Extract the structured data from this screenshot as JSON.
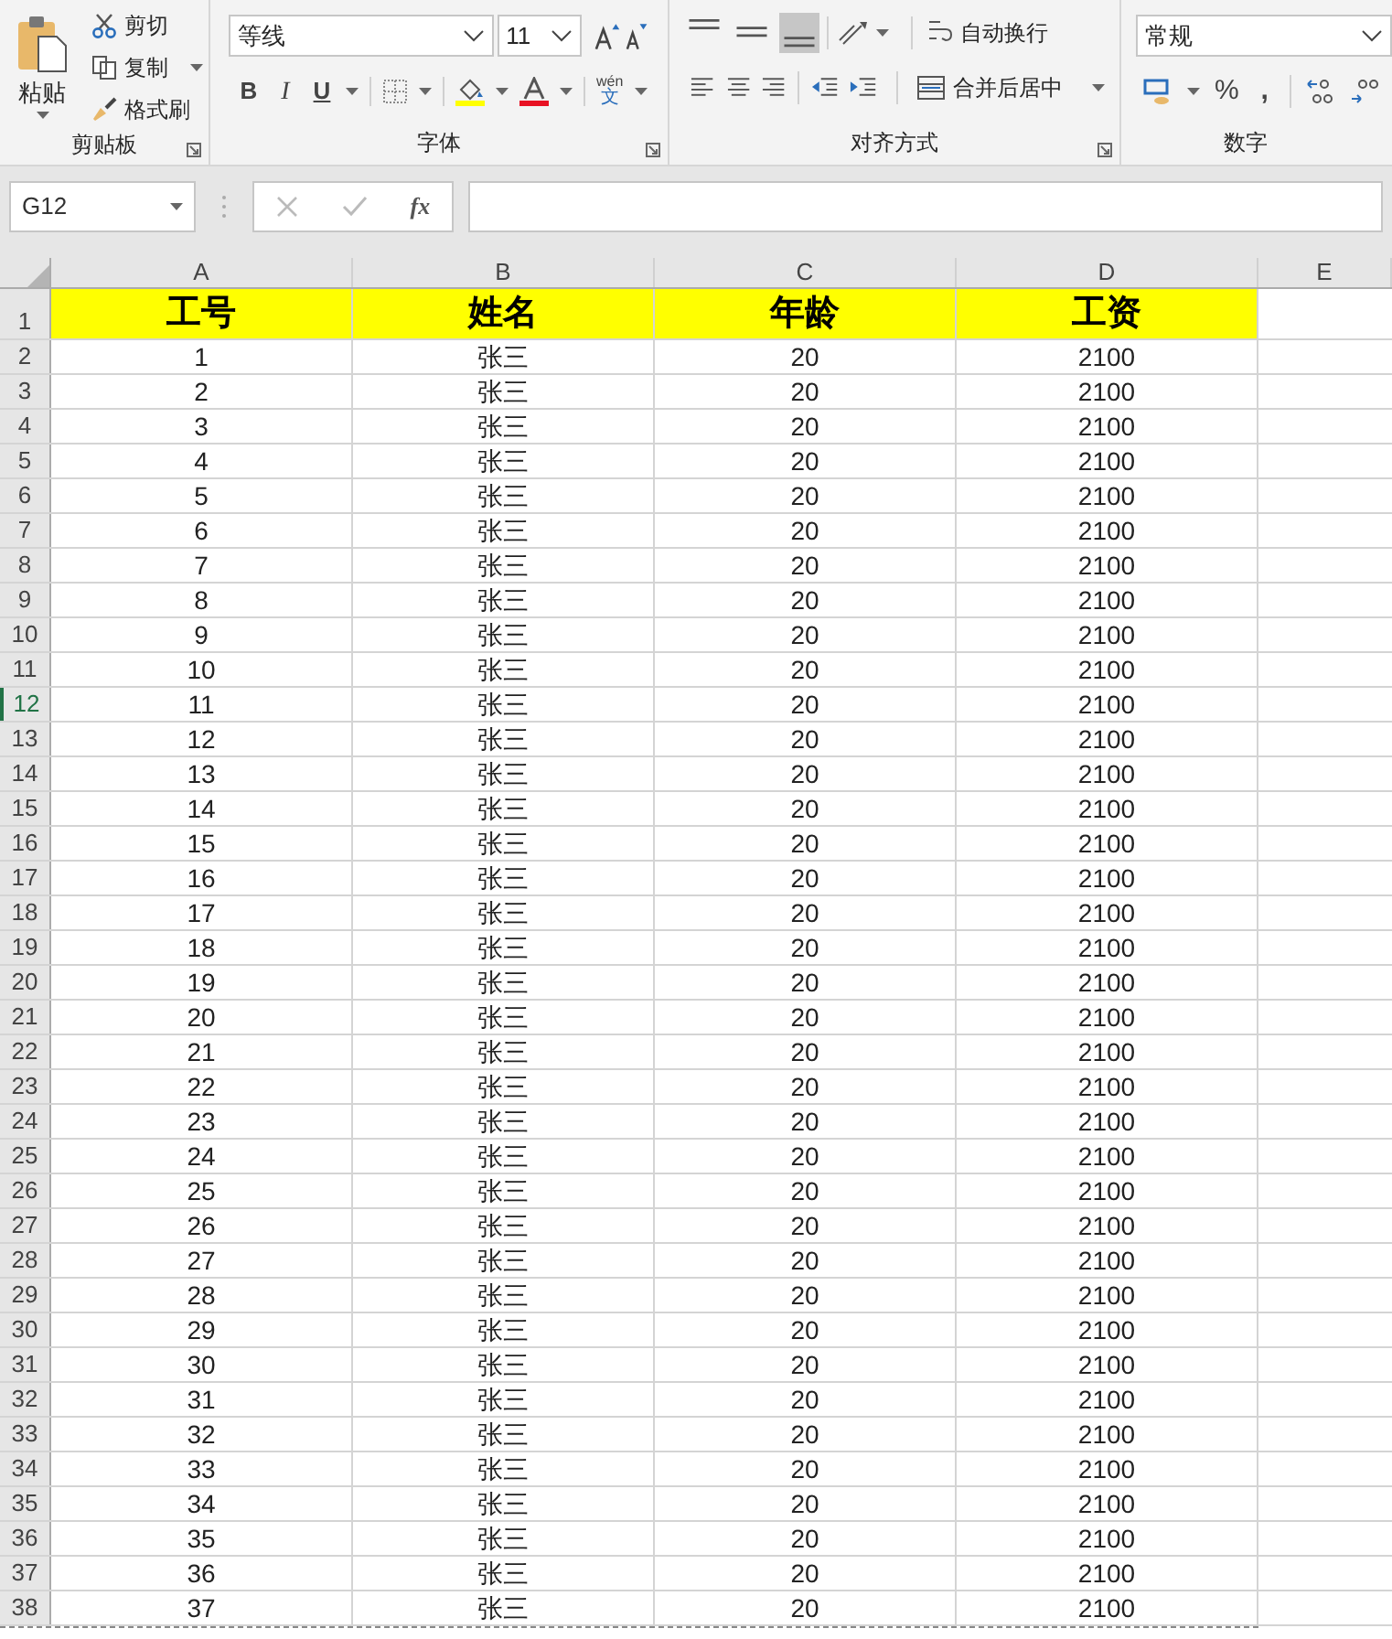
{
  "ribbon": {
    "clipboard": {
      "paste": "粘贴",
      "cut": "剪切",
      "copy": "复制",
      "format_painter": "格式刷",
      "label": "剪贴板"
    },
    "font": {
      "font_name": "等线",
      "font_size": "11",
      "bold": "B",
      "italic": "I",
      "underline": "U",
      "phonetic_top": "wén",
      "phonetic_bottom": "文",
      "label": "字体"
    },
    "alignment": {
      "wrap_text": "自动换行",
      "merge_center": "合并后居中",
      "label": "对齐方式"
    },
    "number": {
      "format": "常规",
      "percent": "%",
      "comma": ",",
      "label": "数字"
    }
  },
  "formula_bar": {
    "name_box": "G12",
    "fx": "fx"
  },
  "columns": [
    {
      "label": "A",
      "selected": false
    },
    {
      "label": "B",
      "selected": false
    },
    {
      "label": "C",
      "selected": false
    },
    {
      "label": "D",
      "selected": false
    },
    {
      "label": "E",
      "selected": false
    }
  ],
  "header_row": {
    "number": "1",
    "cells": [
      "工号",
      "姓名",
      "年龄",
      "工资"
    ]
  },
  "rows": [
    {
      "number": "2",
      "selected": false,
      "cells": [
        "1",
        "张三",
        "20",
        "2100"
      ]
    },
    {
      "number": "3",
      "selected": false,
      "cells": [
        "2",
        "张三",
        "20",
        "2100"
      ]
    },
    {
      "number": "4",
      "selected": false,
      "cells": [
        "3",
        "张三",
        "20",
        "2100"
      ]
    },
    {
      "number": "5",
      "selected": false,
      "cells": [
        "4",
        "张三",
        "20",
        "2100"
      ]
    },
    {
      "number": "6",
      "selected": false,
      "cells": [
        "5",
        "张三",
        "20",
        "2100"
      ]
    },
    {
      "number": "7",
      "selected": false,
      "cells": [
        "6",
        "张三",
        "20",
        "2100"
      ]
    },
    {
      "number": "8",
      "selected": false,
      "cells": [
        "7",
        "张三",
        "20",
        "2100"
      ]
    },
    {
      "number": "9",
      "selected": false,
      "cells": [
        "8",
        "张三",
        "20",
        "2100"
      ]
    },
    {
      "number": "10",
      "selected": false,
      "cells": [
        "9",
        "张三",
        "20",
        "2100"
      ]
    },
    {
      "number": "11",
      "selected": false,
      "cells": [
        "10",
        "张三",
        "20",
        "2100"
      ]
    },
    {
      "number": "12",
      "selected": true,
      "cells": [
        "11",
        "张三",
        "20",
        "2100"
      ]
    },
    {
      "number": "13",
      "selected": false,
      "cells": [
        "12",
        "张三",
        "20",
        "2100"
      ]
    },
    {
      "number": "14",
      "selected": false,
      "cells": [
        "13",
        "张三",
        "20",
        "2100"
      ]
    },
    {
      "number": "15",
      "selected": false,
      "cells": [
        "14",
        "张三",
        "20",
        "2100"
      ]
    },
    {
      "number": "16",
      "selected": false,
      "cells": [
        "15",
        "张三",
        "20",
        "2100"
      ]
    },
    {
      "number": "17",
      "selected": false,
      "cells": [
        "16",
        "张三",
        "20",
        "2100"
      ]
    },
    {
      "number": "18",
      "selected": false,
      "cells": [
        "17",
        "张三",
        "20",
        "2100"
      ]
    },
    {
      "number": "19",
      "selected": false,
      "cells": [
        "18",
        "张三",
        "20",
        "2100"
      ]
    },
    {
      "number": "20",
      "selected": false,
      "cells": [
        "19",
        "张三",
        "20",
        "2100"
      ]
    },
    {
      "number": "21",
      "selected": false,
      "cells": [
        "20",
        "张三",
        "20",
        "2100"
      ]
    },
    {
      "number": "22",
      "selected": false,
      "cells": [
        "21",
        "张三",
        "20",
        "2100"
      ]
    },
    {
      "number": "23",
      "selected": false,
      "cells": [
        "22",
        "张三",
        "20",
        "2100"
      ]
    },
    {
      "number": "24",
      "selected": false,
      "cells": [
        "23",
        "张三",
        "20",
        "2100"
      ]
    },
    {
      "number": "25",
      "selected": false,
      "cells": [
        "24",
        "张三",
        "20",
        "2100"
      ]
    },
    {
      "number": "26",
      "selected": false,
      "cells": [
        "25",
        "张三",
        "20",
        "2100"
      ]
    },
    {
      "number": "27",
      "selected": false,
      "cells": [
        "26",
        "张三",
        "20",
        "2100"
      ]
    },
    {
      "number": "28",
      "selected": false,
      "cells": [
        "27",
        "张三",
        "20",
        "2100"
      ]
    },
    {
      "number": "29",
      "selected": false,
      "cells": [
        "28",
        "张三",
        "20",
        "2100"
      ]
    },
    {
      "number": "30",
      "selected": false,
      "cells": [
        "29",
        "张三",
        "20",
        "2100"
      ]
    },
    {
      "number": "31",
      "selected": false,
      "cells": [
        "30",
        "张三",
        "20",
        "2100"
      ]
    },
    {
      "number": "32",
      "selected": false,
      "cells": [
        "31",
        "张三",
        "20",
        "2100"
      ]
    },
    {
      "number": "33",
      "selected": false,
      "cells": [
        "32",
        "张三",
        "20",
        "2100"
      ]
    },
    {
      "number": "34",
      "selected": false,
      "cells": [
        "33",
        "张三",
        "20",
        "2100"
      ]
    },
    {
      "number": "35",
      "selected": false,
      "cells": [
        "34",
        "张三",
        "20",
        "2100"
      ]
    },
    {
      "number": "36",
      "selected": false,
      "cells": [
        "35",
        "张三",
        "20",
        "2100"
      ]
    },
    {
      "number": "37",
      "selected": false,
      "cells": [
        "36",
        "张三",
        "20",
        "2100"
      ]
    },
    {
      "number": "38",
      "selected": false,
      "cells": [
        "37",
        "张三",
        "20",
        "2100"
      ]
    }
  ]
}
